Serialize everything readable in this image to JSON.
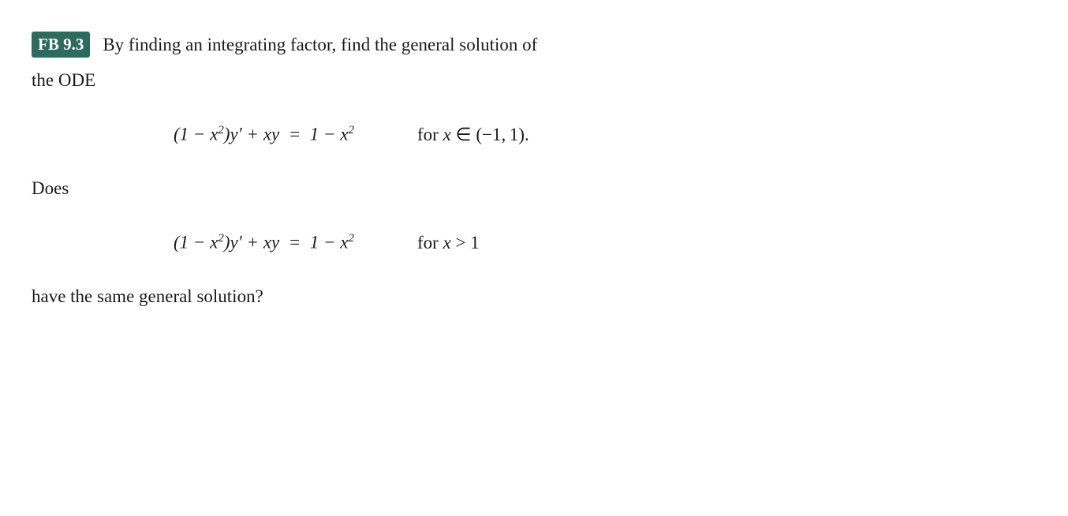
{
  "badge": {
    "label": "FB 9.3"
  },
  "header": {
    "text": "By finding an integrating factor, find the general solution of",
    "ode_text": "the ODE"
  },
  "equation1": {
    "lhs": "(1 − x²)y′ + xy",
    "equals": "=",
    "rhs": "1 − x²",
    "condition": "for x ∈ (−1, 1)."
  },
  "does_label": "Does",
  "equation2": {
    "lhs": "(1 − x²)y′ + xy",
    "equals": "=",
    "rhs": "1 − x²",
    "condition": "for x > 1"
  },
  "conclusion": {
    "text": "have the same general solution?"
  }
}
